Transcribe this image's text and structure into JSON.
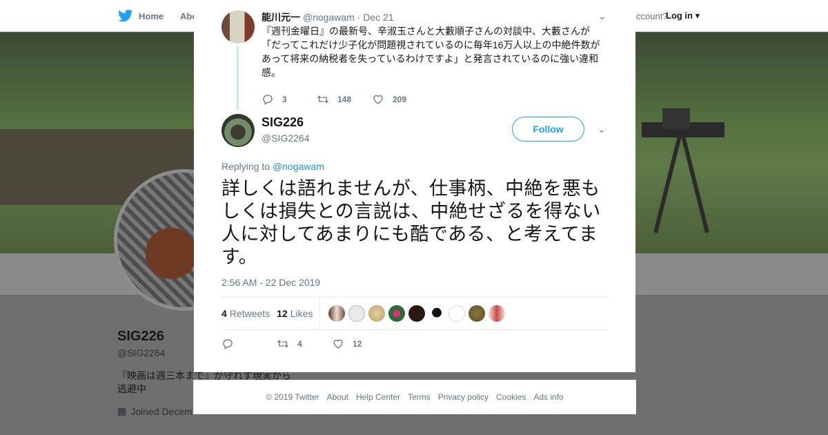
{
  "nav": {
    "home": "Home",
    "about": "Abo",
    "account_text": "ccount?",
    "login": "Log in"
  },
  "profile": {
    "name": "SIG226",
    "handle": "@SIG2264",
    "bio": "『映画は週三本まで』が守れず現実から逃避中",
    "joined": "Joined Decem"
  },
  "parent_tweet": {
    "name": "能川元一",
    "handle": "@nogawam",
    "date": "· Dec 21",
    "text": "『週刊金曜日』の最新号、辛淑玉さんと大藪順子さんの対談中、大藪さんが「だってこれだけ少子化が問題視されているのに毎年16万人以上の中絶件数があって将来の納税者を失っているわけですよ」と発言されているのに強い違和感。",
    "replies": "3",
    "retweets": "148",
    "likes": "209"
  },
  "main_tweet": {
    "name": "SIG226",
    "handle": "@SIG2264",
    "follow_label": "Follow",
    "replying_prefix": "Replying to",
    "replying_handle": "@nogawam",
    "text": "詳しくは語れませんが、仕事柄、中絶を悪もしくは損失との言説は、中絶せざるを得ない人に対してあまりにも酷である、と考えてます。",
    "timestamp": "2:56 AM - 22 Dec 2019",
    "retweets_count": "4",
    "retweets_label": "Retweets",
    "likes_count": "12",
    "likes_label": "Likes",
    "action_retweets": "4",
    "action_likes": "12"
  },
  "footer": [
    "© 2019 Twitter",
    "About",
    "Help Center",
    "Terms",
    "Privacy policy",
    "Cookies",
    "Ads info"
  ],
  "colors": {
    "accent": "#1da1f2",
    "thread_line": "#c4e6f7",
    "muted": "#657786"
  }
}
